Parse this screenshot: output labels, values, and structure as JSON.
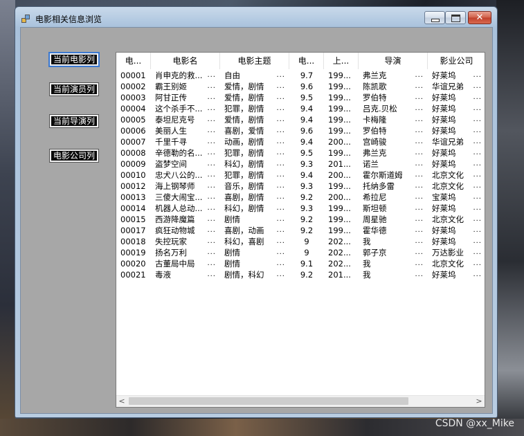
{
  "window": {
    "title": "电影相关信息浏览",
    "close_symbol": "✕"
  },
  "sidebar": {
    "buttons": [
      {
        "label": "当前电影列"
      },
      {
        "label": "当前演员列"
      },
      {
        "label": "当前导演列"
      },
      {
        "label": "电影公司列"
      }
    ]
  },
  "grid": {
    "columns": [
      "电...",
      "电影名",
      "电影主题",
      "电...",
      "上...",
      "导演",
      "影业公司"
    ],
    "rows": [
      [
        "00001",
        "肖申克的救...",
        "自由",
        "9.7",
        "199...",
        "弗兰克",
        "好莱坞"
      ],
      [
        "00002",
        "霸王别姬",
        "爱情，剧情",
        "9.6",
        "199...",
        "陈凯歌",
        "华谊兄弟"
      ],
      [
        "00003",
        "阿甘正传",
        "爱情，剧情",
        "9.5",
        "199...",
        "罗伯特",
        "好莱坞"
      ],
      [
        "00004",
        "这个杀手不...",
        "犯罪，剧情",
        "9.4",
        "199...",
        "吕克.贝松",
        "好莱坞"
      ],
      [
        "00005",
        "泰坦尼克号",
        "爱情，剧情",
        "9.4",
        "199...",
        "卡梅隆",
        "好莱坞"
      ],
      [
        "00006",
        "美丽人生",
        "喜剧，爱情",
        "9.6",
        "199...",
        "罗伯特",
        "好莱坞"
      ],
      [
        "00007",
        "千里千寻",
        "动画，剧情",
        "9.4",
        "200...",
        "宫崎骏",
        "华谊兄弟"
      ],
      [
        "00008",
        "辛德勒的名...",
        "犯罪，剧情",
        "9.5",
        "199...",
        "弗兰克",
        "好莱坞"
      ],
      [
        "00009",
        "盗梦空间",
        "科幻，剧情",
        "9.3",
        "201...",
        "诺兰",
        "好莱坞"
      ],
      [
        "00010",
        "忠犬八公的...",
        "犯罪，剧情",
        "9.4",
        "200...",
        "霍尔斯道姆",
        "北京文化"
      ],
      [
        "00012",
        "海上钢琴师",
        "音乐，剧情",
        "9.3",
        "199...",
        "托纳多雷",
        "北京文化"
      ],
      [
        "00013",
        "三傻大闹宝...",
        "喜剧，剧情",
        "9.2",
        "200...",
        "希拉尼",
        "宝莱坞"
      ],
      [
        "00014",
        "机器人总动...",
        "科幻，剧情",
        "9.3",
        "199...",
        "斯坦顿",
        "好莱坞"
      ],
      [
        "00015",
        "西游降魔篇",
        "剧情",
        "9.2",
        "199...",
        "周星驰",
        "北京文化"
      ],
      [
        "00017",
        "疯狂动物城",
        "喜剧，动画",
        "9.2",
        "199...",
        "霍华德",
        "好莱坞"
      ],
      [
        "00018",
        "失控玩家",
        "科幻，喜剧",
        "9",
        "202...",
        "我",
        "好莱坞"
      ],
      [
        "00019",
        "扬名万利",
        "剧情",
        "9",
        "202...",
        "郭子京",
        "万达影业"
      ],
      [
        "00020",
        "古董局中局",
        "剧情",
        "9.1",
        "202...",
        "我",
        "北京文化"
      ],
      [
        "00021",
        "毒液",
        "剧情，科幻",
        "9.2",
        "201...",
        "我",
        "好莱坞"
      ]
    ]
  },
  "scrollbar": {
    "left_arrow": "<",
    "right_arrow": ">"
  },
  "watermark": "CSDN @xx_Mike"
}
